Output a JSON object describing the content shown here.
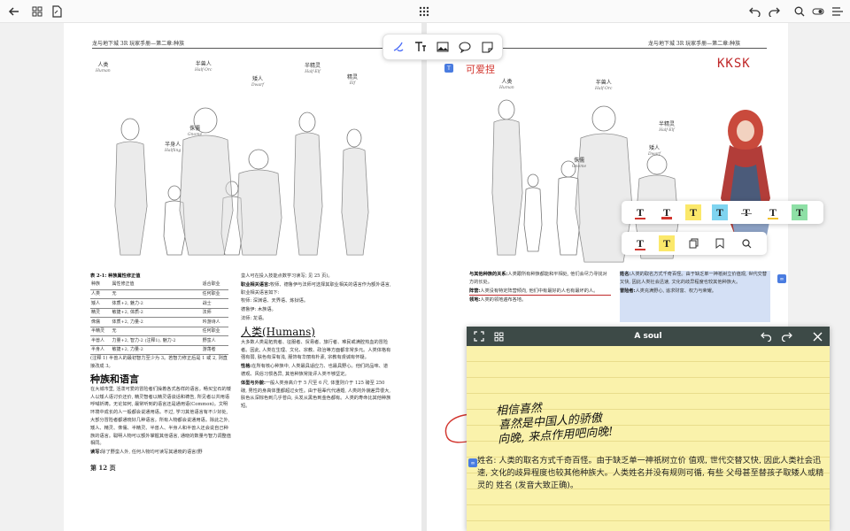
{
  "toolbar": {
    "back_icon": "arrow-left-icon",
    "grid_icon": "grid-icon",
    "export_icon": "document-export-icon",
    "apps_icon": "apps-grid-icon",
    "undo_icon": "undo-icon",
    "redo_icon": "redo-icon",
    "search_icon": "search-icon",
    "toggle_icon": "toggle-icon",
    "menu_icon": "menu-icon"
  },
  "annotation_bar": {
    "tools": [
      "lasso-pen-icon",
      "text-tool-icon",
      "image-tool-icon",
      "comment-icon",
      "sticky-note-icon"
    ]
  },
  "left_page": {
    "header": "龙与地下城 3R 玩家手册—第二章:种族",
    "figure_labels": [
      {
        "cn": "人类",
        "en": "Human"
      },
      {
        "cn": "半兽人",
        "en": "Half-Orc"
      },
      {
        "cn": "矮人",
        "en": "Dwarf"
      },
      {
        "cn": "半精灵",
        "en": "Half-Elf"
      },
      {
        "cn": "精灵",
        "en": "Elf"
      },
      {
        "cn": "侏儒",
        "en": "Gnome"
      },
      {
        "cn": "半身人",
        "en": "Halfling"
      }
    ],
    "table_title": "表 2-1: 种族属性修正值",
    "table_rows": [
      [
        "种族",
        "属性修正值",
        "适合职业"
      ],
      [
        "人类",
        "无",
        "任何职业"
      ],
      [
        "矮人",
        "体质+2, 魅力-2",
        "战士"
      ],
      [
        "精灵",
        "敏捷+2, 体质-2",
        "法师"
      ],
      [
        "侏儒",
        "体质+2, 力量-2",
        "吟游诗人"
      ],
      [
        "半精灵",
        "无",
        "任何职业"
      ],
      [
        "半兽人",
        "力量+2, 智力-2 (注释1), 魅力-2",
        "野蛮人"
      ],
      [
        "半身人",
        "敏捷+2, 力量-2",
        "游荡者"
      ]
    ],
    "table_note": "(注释 1) 半兽人的最初智力至少为 3。若智力修正后是 1 或 2, 则直接改成 3。",
    "section_title": "种族和语言",
    "section_body": "在大城市里, 活泼可爱的冒险者们操着各式各样的语言。畅买宝石的矮人以矮人语讨价还价, 精灵智者以精灵语谈话和祷告, 所见者以共用语呼喊祈祷。无论如何, 最常听到的语言还是通用语(Common)。文明环境中成长的人一般都会说通用语。不过, 学习其他语言有不少好处, 大部分冒险者都通晓好几种语言。所有人物都会说通用语。除此之外, 矮人、精灵、侏儒、半精灵、半兽人、半身人和半兽人还会说自己种族的语言。聪明人物可以额外掌握其他语言, 通晓的数量与智力调整值相同。",
    "section_note_label": "读写:",
    "section_note": "除了野蛮人外, 任何人物均可读写其通晓的语言(野",
    "page_number": "第 12 页",
    "col2_text": "蛮人可在投入技能点数学习读写; 见 25 页)。",
    "col2_items": [
      {
        "label": "职业相关语言:",
        "text": "牧师、德鲁伊与法师可选择其职业相关的语言作为额外语言, 职业相关语言如下:"
      },
      {
        "label": "",
        "text": "牧师: 深渊语、天界语、炼狱语。"
      },
      {
        "label": "",
        "text": "德鲁伊: 木族语。"
      },
      {
        "label": "",
        "text": "法师: 龙语。"
      }
    ],
    "human_title": "人类(Humans)",
    "human_body": "大多数人类是拓荒者、征服者、贸易者、旅行者、难民或满腔热血的冒险者。因此, 人类在生理、文化、宗教、政治等方面都非常多元。人类体格有强有弱, 肤色有深有浅, 服饰有华丽有朴素, 宗教有虔诚有怀疑。",
    "personality_label": "性格:",
    "personality": "在所有核心种族中, 人类最具适应力、也最具野心。他们的品味、道德观、风俗习惯各异, 其他种族常批评人类不够坚定。",
    "physical_label": "体型与外貌:",
    "physical": "一般人类身高介于 5 尺至 6 尺, 体重则介于 125 磅至 250 磅, 男性的身高体重都超过女性。由于祖辈代代通婚, 人类的外貌差异很大, 肤色从深棕色到几乎苍白, 头发从黑色到金色都有。人类的寿命比其他种族短。"
  },
  "right_page": {
    "header": "龙与地下城 3R 玩家手册—第二章:种族",
    "text_box_label": "可爱捏",
    "handwriting_top": "KKSK",
    "body_left": [
      {
        "label": "与其他种族的关系:",
        "text": "人类跟所有种族都能和平相处, 他们会尽力寻找对方的长处。"
      },
      {
        "label": "阵营:",
        "text": "人类没有特定阵营倾向, 他们中有最好的人也有最坏的人。"
      },
      {
        "label": "领地:",
        "text": "人类的领地遍布各地。"
      }
    ],
    "body_right": [
      {
        "label": "姓名:",
        "text": "人类的取名方式千奇百怪。由于缺乏单一神祇树立价值观, 世代交替又快, 因此人类社会迅速, 文化的歧异程度也较其他种族大。"
      },
      {
        "label": "冒险者:",
        "text": "人类充满野心, 追求财富、权力与荣耀。"
      }
    ]
  },
  "palette_top": {
    "styles": [
      "text-style-underline-red",
      "text-style-underline-red-bold",
      "text-style-highlight-yellow",
      "text-style-highlight-blue",
      "text-style-strike",
      "text-style-underline-yellow",
      "text-style-highlight-green"
    ]
  },
  "palette_bottom": {
    "styles": [
      "text-style-underline-red",
      "text-style-highlight-yellow"
    ],
    "actions": [
      "copy-icon",
      "bookmark-icon",
      "search-icon"
    ]
  },
  "note": {
    "title": "A soul",
    "handwriting": [
      "相信喜然",
      "喜然是中国人的骄傲",
      "向晚, 来点作用吧向晚!"
    ],
    "text": "姓名: 人类的取名方式千奇百怪。由于缺乏单一神祇树立价 值观, 世代交替又快, 因此人类社会迅速, 文化的歧异程度也较其他种族大。人类姓名并没有规则可循, 有些 父母甚至替孩子取矮人或精灵的 姓名 (发音大致正确)。"
  }
}
